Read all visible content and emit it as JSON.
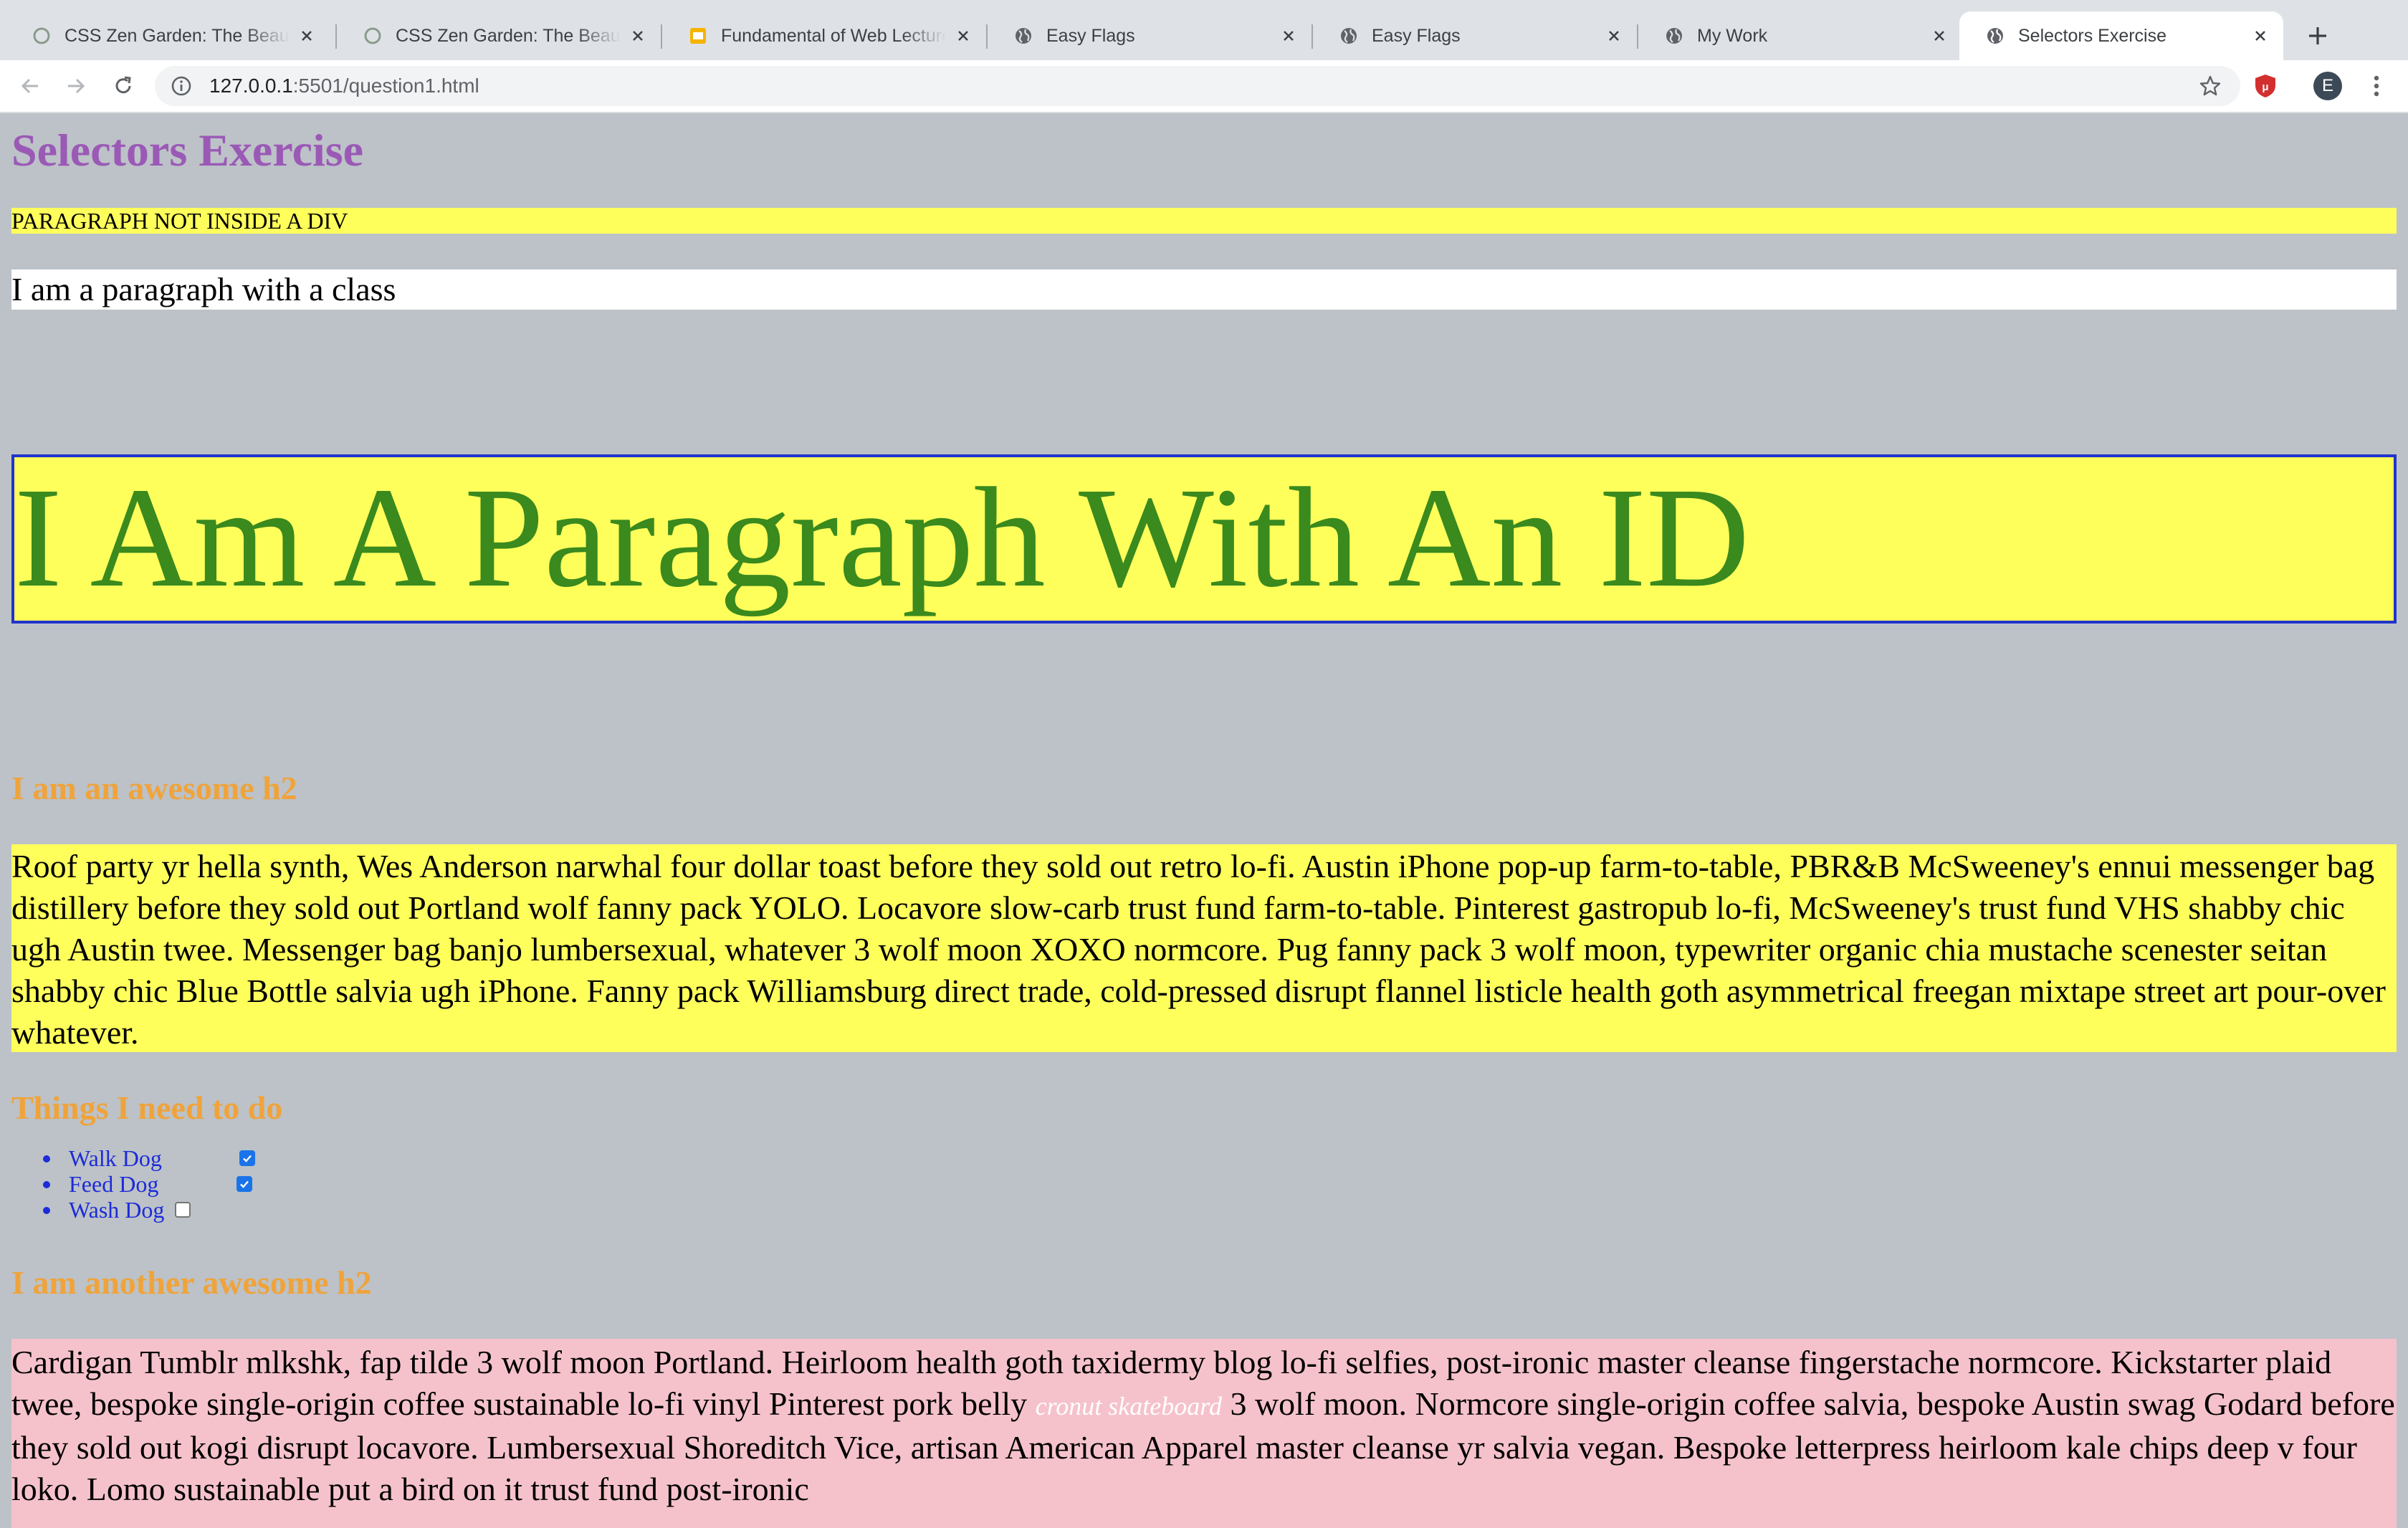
{
  "browser": {
    "tabs": [
      {
        "title": "CSS Zen Garden: The Beauty of CSS Design",
        "icon": "zen-garden-icon",
        "active": false
      },
      {
        "title": "CSS Zen Garden: The Beauty of CSS Design",
        "icon": "zen-garden-icon",
        "active": false
      },
      {
        "title": "Fundamental of Web Lectures",
        "icon": "slides-icon",
        "active": false
      },
      {
        "title": "Easy Flags",
        "icon": "globe-icon",
        "active": false
      },
      {
        "title": "Easy Flags",
        "icon": "globe-icon",
        "active": false
      },
      {
        "title": "My Work",
        "icon": "globe-icon",
        "active": false
      },
      {
        "title": "Selectors Exercise",
        "icon": "globe-icon",
        "active": true
      }
    ],
    "address": {
      "host": "127.0.0.1",
      "rest": ":5501/question1.html"
    },
    "profile_initial": "E"
  },
  "page": {
    "title": "Selectors Exercise",
    "p_not_in_div": "PARAGRAPH NOT INSIDE A DIV",
    "p_with_class": "I am a paragraph with a class",
    "p_with_id": "I Am A Paragraph With An ID",
    "h2_awesome": "I am an awesome h2",
    "lorem_1": "Roof party yr hella synth, Wes Anderson narwhal four dollar toast before they sold out retro lo-fi. Austin iPhone pop-up farm-to-table, PBR&B McSweeney's ennui messenger bag distillery before they sold out Portland wolf fanny pack YOLO. Locavore slow-carb trust fund farm-to-table. Pinterest gastropub lo-fi, McSweeney's trust fund VHS shabby chic ugh Austin twee. Messenger bag banjo lumbersexual, whatever 3 wolf moon XOXO normcore. Pug fanny pack 3 wolf moon, typewriter organic chia mustache scenester seitan shabby chic Blue Bottle salvia ugh iPhone. Fanny pack Williamsburg direct trade, cold-pressed disrupt flannel listicle health goth asymmetrical freegan mixtape street art pour-over whatever.",
    "h2_todo": "Things I need to do",
    "todo": [
      {
        "label": "Walk Dog",
        "checked": true
      },
      {
        "label": "Feed Dog",
        "checked": true
      },
      {
        "label": "Wash Dog",
        "checked": false
      }
    ],
    "h2_another": "I am another awesome h2",
    "lorem_2_before": "Cardigan Tumblr mlkshk, fap tilde 3 wolf moon Portland. Heirloom health goth taxidermy blog lo-fi selfies, post-ironic master cleanse fingerstache normcore. Kickstarter plaid twee, bespoke single-origin coffee sustainable lo-fi vinyl Pinterest pork belly ",
    "lorem_2_em": "cronut skateboard",
    "lorem_2_after": " 3 wolf moon. Normcore single-origin coffee salvia, bespoke Austin swag Godard before they sold out kogi disrupt locavore. Lumbersexual Shoreditch Vice, artisan American Apparel master cleanse yr salvia vegan. Bespoke letterpress heirloom kale chips deep v four loko. Lomo sustainable put a bird on it trust fund post-ironic"
  }
}
